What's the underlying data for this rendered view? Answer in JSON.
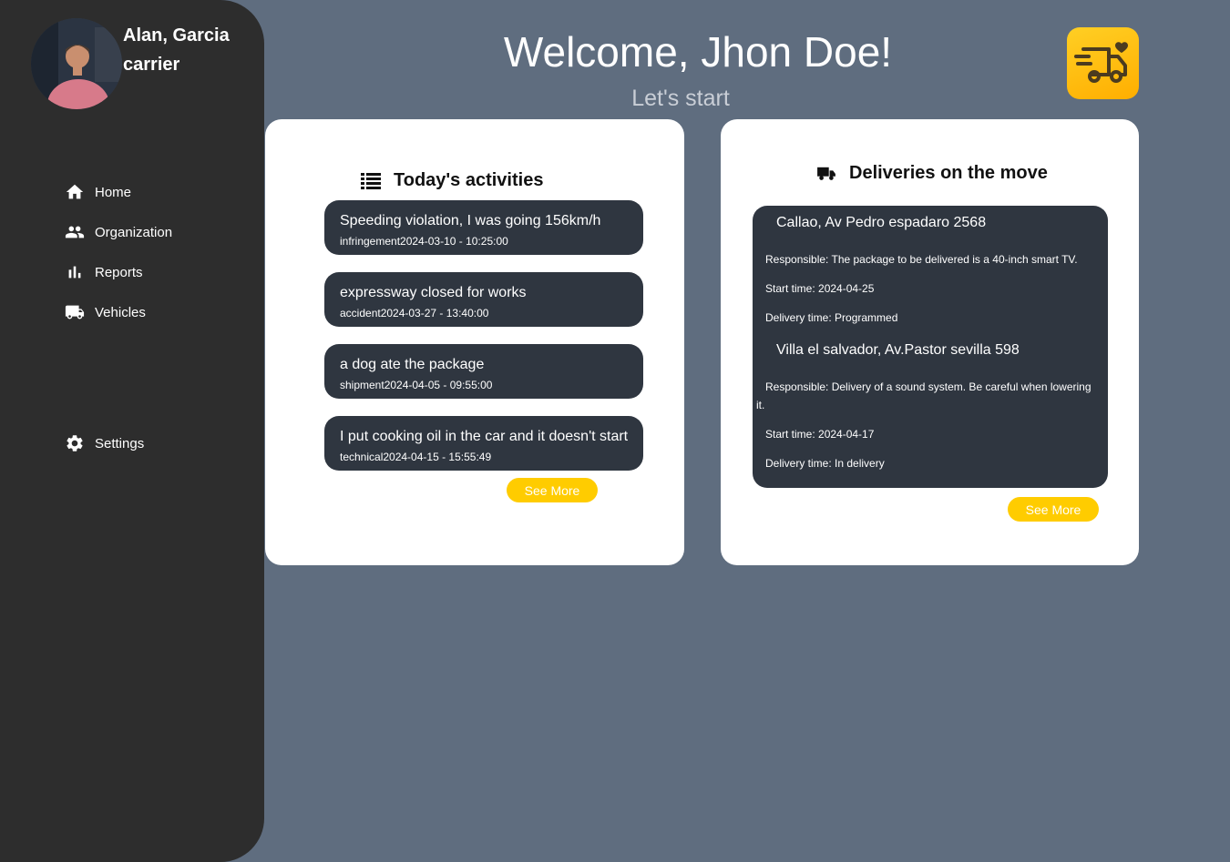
{
  "user": {
    "name": "Alan, Garcia",
    "role": "carrier"
  },
  "nav": {
    "home": "Home",
    "organization": "Organization",
    "reports": "Reports",
    "vehicles": "Vehicles",
    "settings": "Settings"
  },
  "header": {
    "title": "Welcome, Jhon Doe!",
    "subtitle": "Let's start"
  },
  "activities": {
    "heading": "Today's activities",
    "items": [
      {
        "title": "Speeding violation, I was going 156km/h",
        "meta": "infringement2024-03-10 - 10:25:00"
      },
      {
        "title": "expressway closed for works",
        "meta": "accident2024-03-27 - 13:40:00"
      },
      {
        "title": "a dog ate the package",
        "meta": "shipment2024-04-05 - 09:55:00"
      },
      {
        "title": "I put cooking oil in the car and it doesn't start",
        "meta": "technical2024-04-15 - 15:55:49"
      }
    ],
    "see_more": "See More"
  },
  "deliveries": {
    "heading": "Deliveries on the move",
    "items": [
      {
        "address": "Callao, Av Pedro espadaro 2568",
        "responsible": "Responsible: The package to be delivered is a 40-inch smart TV.",
        "start": "Start time: 2024-04-25",
        "delivery": "Delivery time: Programmed"
      },
      {
        "address": "Villa el salvador, Av.Pastor sevilla 598",
        "responsible": "Responsible: Delivery of a sound system. Be careful when lowering it.",
        "start": "Start time: 2024-04-17",
        "delivery": "Delivery time: In delivery"
      }
    ],
    "see_more": "See More"
  },
  "colors": {
    "accent": "#ffcc00",
    "sidebar": "#2d2d2d",
    "background": "#5f6d7f",
    "item_bg": "#2f3640"
  }
}
